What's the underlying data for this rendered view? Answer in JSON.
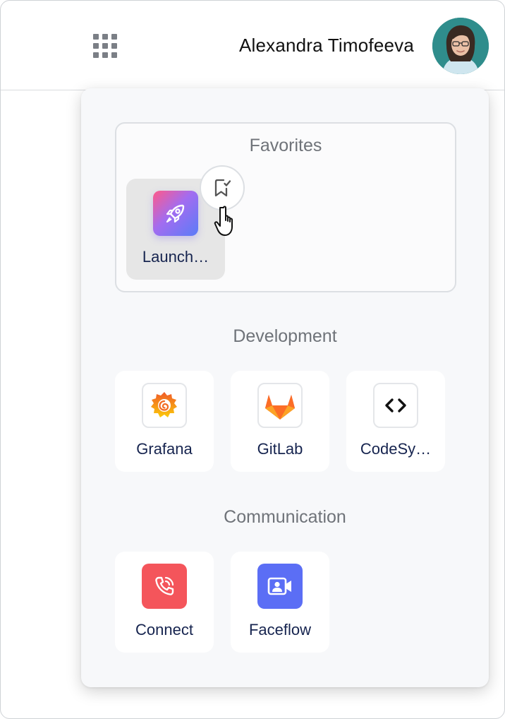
{
  "header": {
    "apps_icon": "grid-icon",
    "user_name": "Alexandra Timofeeva",
    "avatar_icon": "user-avatar"
  },
  "panel": {
    "favorites": {
      "title": "Favorites",
      "items": [
        {
          "label": "Launch…",
          "icon": "rocket-icon"
        }
      ],
      "bookmark_icon": "bookmark-check-icon"
    },
    "development": {
      "title": "Development",
      "items": [
        {
          "label": "Grafana",
          "icon": "grafana-icon"
        },
        {
          "label": "GitLab",
          "icon": "gitlab-icon"
        },
        {
          "label": "CodeSy…",
          "icon": "code-icon"
        }
      ]
    },
    "communication": {
      "title": "Communication",
      "items": [
        {
          "label": "Connect",
          "icon": "phone-icon",
          "color": "#f4555b"
        },
        {
          "label": "Faceflow",
          "icon": "video-icon",
          "color": "#5b6ef5"
        }
      ]
    }
  }
}
